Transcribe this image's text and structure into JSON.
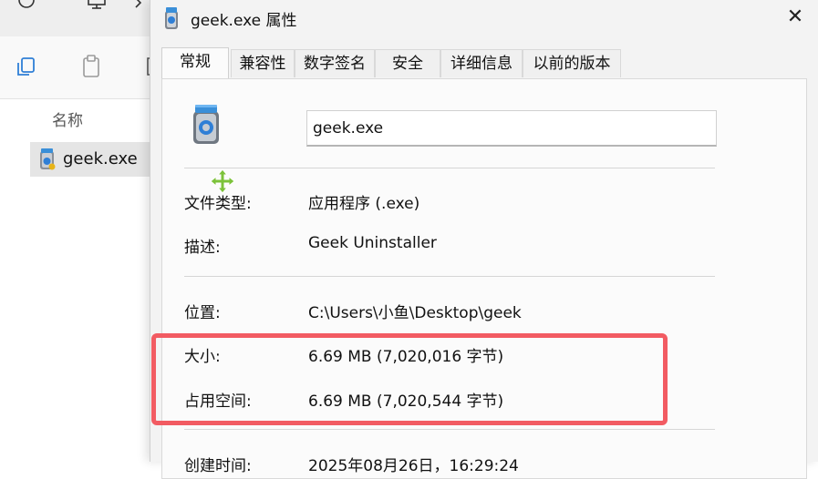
{
  "explorer": {
    "column_header": "名称",
    "file_name": "geek.exe"
  },
  "dialog": {
    "title": "geek.exe 属性",
    "close_glyph": "✕",
    "tabs": [
      {
        "label": "常规",
        "active": true
      },
      {
        "label": "兼容性",
        "active": false
      },
      {
        "label": "数字签名",
        "active": false
      },
      {
        "label": "安全",
        "active": false
      },
      {
        "label": "详细信息",
        "active": false
      },
      {
        "label": "以前的版本",
        "active": false
      }
    ],
    "file_name_value": "geek.exe",
    "properties": {
      "type_label": "文件类型:",
      "type_value": "应用程序 (.exe)",
      "desc_label": "描述:",
      "desc_value": "Geek Uninstaller",
      "location_label": "位置:",
      "location_value": "C:\\Users\\小鱼\\Desktop\\geek",
      "size_label": "大小:",
      "size_value": "6.69 MB (7,020,016 字节)",
      "disk_label": "占用空间:",
      "disk_value": "6.69 MB (7,020,544 字节)",
      "created_label": "创建时间:",
      "created_value": "2025年08月26日，16:29:24"
    }
  },
  "colors": {
    "highlight": "#f25b62",
    "panel": "#fbfbfb",
    "dialog_bg": "#f3f3f3",
    "accent_icon": "#2f7fd6"
  }
}
